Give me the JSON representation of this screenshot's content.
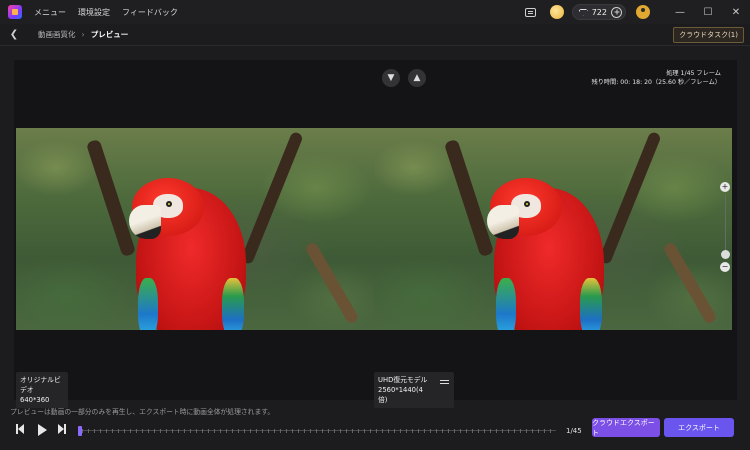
{
  "titlebar": {
    "menu": [
      "メニュー",
      "環境設定",
      "フィードバック"
    ],
    "gems_count": "722",
    "controls": {
      "minimize": "—",
      "maximize": "☐",
      "close": "✕"
    }
  },
  "nav": {
    "back_icon": "chevron-left-icon",
    "crumb_root": "動画画質化",
    "crumb_sep": "›",
    "crumb_current": "プレビュー",
    "cloud_task": "クラウドタスク(1)"
  },
  "preview": {
    "frame_progress": "処理 1/45 フレーム",
    "remaining_time": "残り時間: 00: 18: 20（25.60 秒／フレーム）",
    "left_label": {
      "title": "オリジナルビデオ",
      "resolution": "640*360"
    },
    "right_label": {
      "title": "UHD復元モデル",
      "resolution": "2560*1440(4倍)"
    }
  },
  "footer": {
    "notice": "プレビューは動画の一部分のみを再生し、エクスポート時に動画全体が処理されます。",
    "frame_count": "1/45",
    "cloud_export": "クラウドエクスポート",
    "export": "エクスポート"
  },
  "colors": {
    "accent": "#7c4fe6",
    "export": "#6a55ef",
    "background": "#1c1c1e"
  }
}
